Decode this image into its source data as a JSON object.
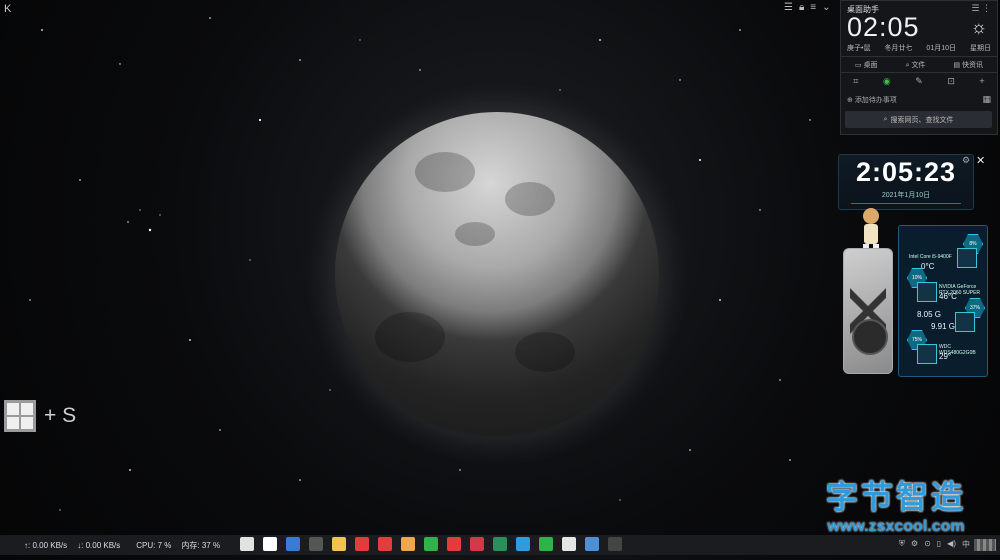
{
  "top_left_icon": "K",
  "assistant": {
    "title": "桌面助手",
    "clock": "02:05",
    "date_lunar": "庚子•鼠",
    "date_month": "冬月廿七",
    "date_day": "01月10日",
    "weekday": "星期日",
    "tabs": [
      "桌面",
      "文件",
      "快资讯"
    ],
    "todo_placeholder": "添加待办事项",
    "search_placeholder": "搜索网页、查找文件"
  },
  "digital_clock": {
    "time": "2:05:23",
    "date": "2021年1月10日"
  },
  "hardware": {
    "cpu_name": "Intel Core i5-9400F",
    "cpu_usage": "8%",
    "cpu_temp": "0°C",
    "gpu_name": "NVIDIA GeForce RTX 2060 SUPER",
    "gpu_usage": "10%",
    "gpu_temp": "46°C",
    "mem_usage": "37%",
    "mem_used": "8.05 G",
    "mem_total": "9.91 G",
    "disk_name": "WDC WDS480G2G0B",
    "disk_usage": "75%",
    "disk_temp": "29°"
  },
  "shortcut": {
    "plus_key": "+ S"
  },
  "watermark": {
    "title": "字节智造",
    "url": "www.zsxcool.com"
  },
  "taskbar": {
    "upload": "↑: 0.00 KB/s",
    "download": "↓: 0.00 KB/s",
    "cpu": "CPU: 7 %",
    "memory": "内存: 37 %",
    "app_colors": [
      "#e2e2e2",
      "#ffffff",
      "#3a7bd5",
      "#555555",
      "#f2c14e",
      "#e23c3c",
      "#e23c3c",
      "#f0a64a",
      "#2fb24a",
      "#e23c3c",
      "#d23a4a",
      "#2a8f5a",
      "#2f9bdc",
      "#2fb24a",
      "#e6e6e6",
      "#4e8fd6",
      "#444444"
    ]
  }
}
